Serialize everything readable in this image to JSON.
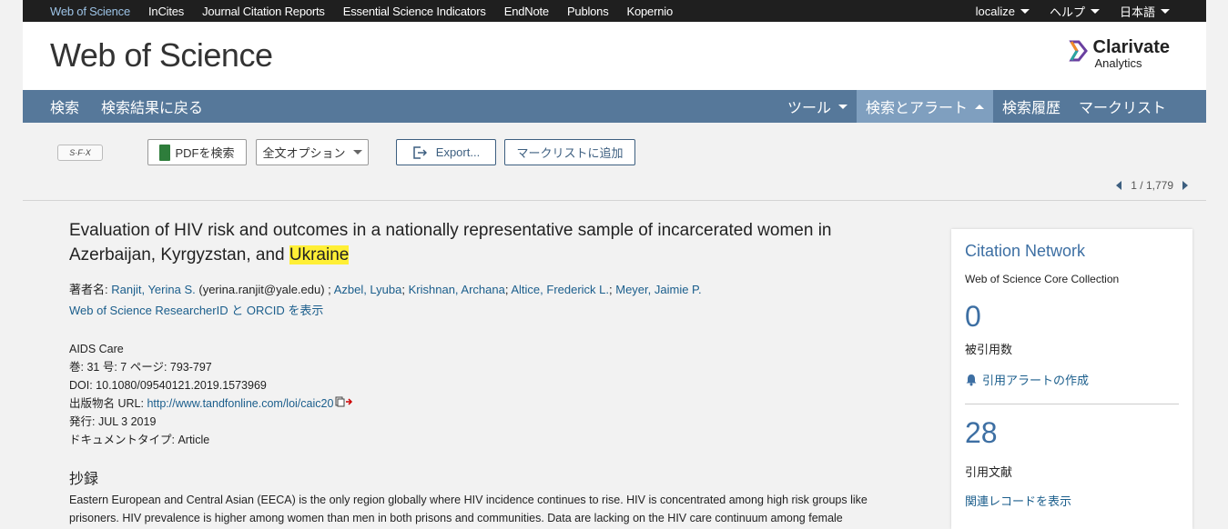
{
  "topbar": {
    "links": [
      "Web of Science",
      "InCites",
      "Journal Citation Reports",
      "Essential Science Indicators",
      "EndNote",
      "Publons",
      "Kopernio"
    ],
    "menus": [
      "localize",
      "ヘルプ",
      "日本語"
    ]
  },
  "header": {
    "brand": "Web of Science",
    "logo_line1": "Clarivate",
    "logo_line2": "Analytics"
  },
  "nav": {
    "search": "検索",
    "back": "検索結果に戻る",
    "tools": "ツール",
    "search_alert": "検索とアラート",
    "history": "検索履歴",
    "marklist": "マークリスト"
  },
  "toolbar": {
    "sfx": "S·F·X",
    "pdf": "PDFを検索",
    "fulltext": "全文オプション",
    "export": "Export...",
    "add_marklist": "マークリストに追加",
    "pager": "1 / 1,779"
  },
  "record": {
    "title_main": "Evaluation of HIV risk and outcomes in a nationally representative sample of incarcerated women in Azerbaijan, Kyrgyzstan, and ",
    "title_highlight": "Ukraine",
    "authors_label": "著者名: ",
    "author1": "Ranjit, Yerina S.",
    "author1_email": " (yerina.ranjit@yale.edu) ; ",
    "author2": "Azbel, Lyuba",
    "author3": "Krishnan, Archana",
    "author4": "Altice, Frederick L.",
    "author5": "Meyer, Jaimie P.",
    "researcher_link": "Web of Science ResearcherID と ORCID を表示",
    "journal": "AIDS Care",
    "volume": "巻: 31 号: 7 ページ: 793-797",
    "doi": "DOI: 10.1080/09540121.2019.1573969",
    "url_label": "出版物名 URL: ",
    "url": "http://www.tandfonline.com/loi/caic20",
    "published": "発行:  JUL 3 2019",
    "doctype": "ドキュメントタイプ: Article",
    "abstract_heading": "抄録",
    "abstract": "Eastern European and Central Asian (EECA) is the only region globally where HIV incidence continues to rise. HIV is concentrated among high risk groups like prisoners. HIV prevalence is higher among women than men in both prisons and communities. Data are lacking on the HIV care continuum among female"
  },
  "sidebar": {
    "heading": "Citation Network",
    "collection": "Web of Science Core Collection",
    "cited_count": "0",
    "cited_label": "被引用数",
    "alert": "引用アラートの作成",
    "refs_count": "28",
    "refs_label": "引用文献",
    "related": "関連レコードを表示"
  },
  "colors": {
    "accent": "#56789a",
    "link": "#1b5e8c",
    "highlight": "#ffef36"
  }
}
